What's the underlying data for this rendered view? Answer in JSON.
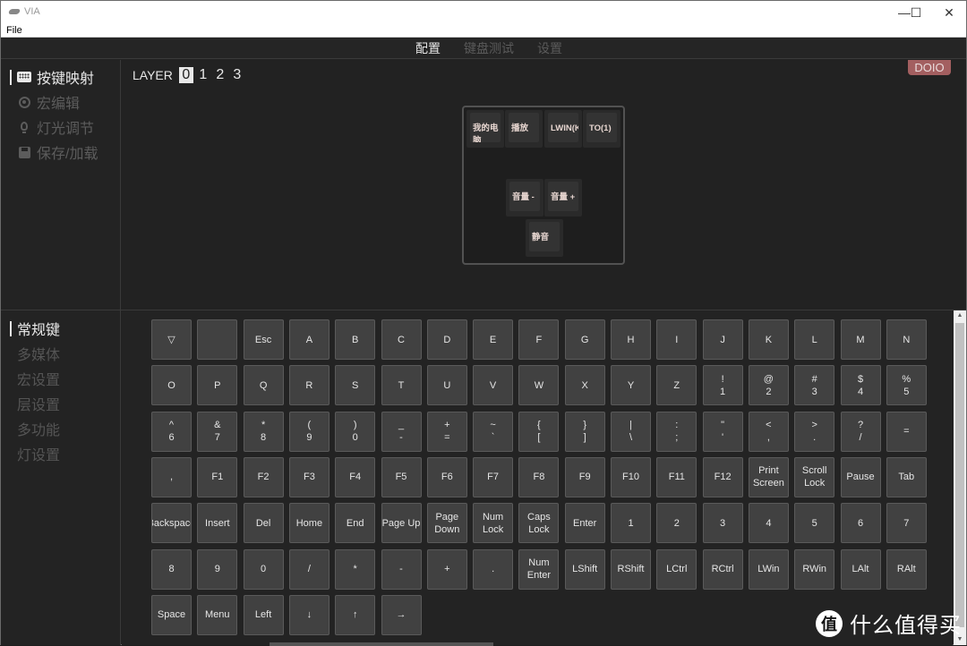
{
  "window": {
    "title": "VIA",
    "controls": {
      "minimize": "—",
      "maximize": "☐",
      "close": "✕"
    }
  },
  "menubar": {
    "file": "File"
  },
  "topnav": {
    "tabs": [
      {
        "label": "配置",
        "active": true
      },
      {
        "label": "键盘测试",
        "active": false
      },
      {
        "label": "设置",
        "active": false
      }
    ]
  },
  "sidebar": {
    "items": [
      {
        "label": "按键映射",
        "icon": "keyboard-icon",
        "active": true
      },
      {
        "label": "宏编辑",
        "icon": "target-icon",
        "active": false
      },
      {
        "label": "灯光调节",
        "icon": "lightbulb-icon",
        "active": false
      },
      {
        "label": "保存/加载",
        "icon": "save-icon",
        "active": false
      }
    ]
  },
  "layer": {
    "label": "LAYER",
    "options": [
      "0",
      "1",
      "2",
      "3"
    ],
    "selected": "0"
  },
  "device_badge": "DOIO",
  "board_keys": [
    [
      "我的电脑"
    ],
    [
      "播放"
    ],
    [
      "LWIN(KC"
    ],
    [
      "TO(1)"
    ],
    [
      "音量 -"
    ],
    [
      "音量 +"
    ],
    [
      "静音"
    ]
  ],
  "categories": {
    "items": [
      {
        "label": "常规键",
        "active": true
      },
      {
        "label": "多媒体",
        "active": false
      },
      {
        "label": "宏设置",
        "active": false
      },
      {
        "label": "层设置",
        "active": false
      },
      {
        "label": "多功能",
        "active": false
      },
      {
        "label": "灯设置",
        "active": false
      }
    ]
  },
  "keycodes": [
    [
      "▽",
      "",
      "Esc",
      "A",
      "B",
      "C",
      "D",
      "E",
      "F",
      "G",
      "H",
      "I",
      "J",
      "K",
      "L",
      "M",
      "N"
    ],
    [
      "O",
      "P",
      "Q",
      "R",
      "S",
      "T",
      "U",
      "V",
      "W",
      "X",
      "Y",
      "Z",
      "!\n1",
      "@\n2",
      "#\n3",
      "$\n4",
      "%\n5"
    ],
    [
      "^\n6",
      "&\n7",
      "*\n8",
      "(\n9",
      ")\n0",
      "_\n-",
      "+\n=",
      "~\n`",
      "{\n[",
      "}\n]",
      "|\n\\",
      ":\n;",
      "\"\n'",
      "<\n,",
      ">\n.",
      "?\n/",
      "="
    ],
    [
      ",",
      "F1",
      "F2",
      "F3",
      "F4",
      "F5",
      "F6",
      "F7",
      "F8",
      "F9",
      "F10",
      "F11",
      "F12",
      "Print\nScreen",
      "Scroll\nLock",
      "Pause",
      "Tab"
    ],
    [
      "Backspace",
      "Insert",
      "Del",
      "Home",
      "End",
      "Page Up",
      "Page\nDown",
      "Num\nLock",
      "Caps\nLock",
      "Enter",
      "1",
      "2",
      "3",
      "4",
      "5",
      "6",
      "7"
    ],
    [
      "8",
      "9",
      "0",
      "/",
      "*",
      "-",
      "+",
      ".",
      "Num\nEnter",
      "LShift",
      "RShift",
      "LCtrl",
      "RCtrl",
      "LWin",
      "RWin",
      "LAlt",
      "RAlt"
    ],
    [
      "Space",
      "Menu",
      "Left",
      "↓",
      "↑",
      "→"
    ]
  ],
  "watermark": {
    "logo": "值",
    "text": "什么值得买"
  }
}
